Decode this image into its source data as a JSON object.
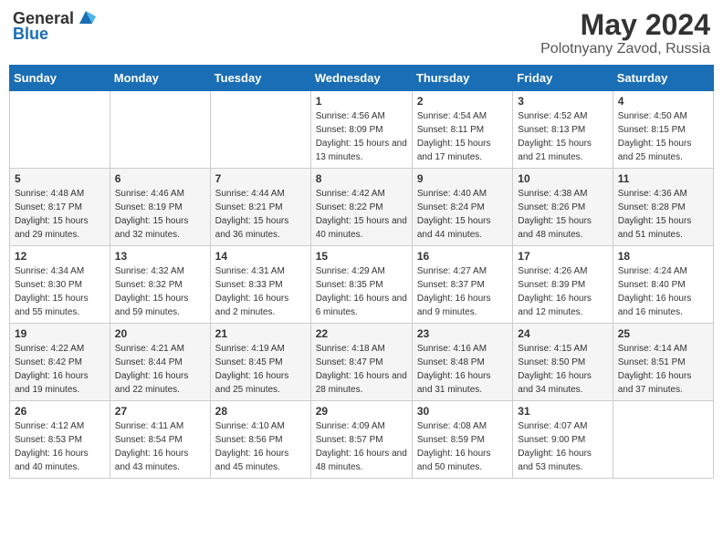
{
  "header": {
    "logo_general": "General",
    "logo_blue": "Blue",
    "title": "May 2024",
    "location": "Polotnyany Zavod, Russia"
  },
  "columns": [
    "Sunday",
    "Monday",
    "Tuesday",
    "Wednesday",
    "Thursday",
    "Friday",
    "Saturday"
  ],
  "weeks": [
    [
      {
        "day": "",
        "sunrise": "",
        "sunset": "",
        "daylight": ""
      },
      {
        "day": "",
        "sunrise": "",
        "sunset": "",
        "daylight": ""
      },
      {
        "day": "",
        "sunrise": "",
        "sunset": "",
        "daylight": ""
      },
      {
        "day": "1",
        "sunrise": "Sunrise: 4:56 AM",
        "sunset": "Sunset: 8:09 PM",
        "daylight": "Daylight: 15 hours and 13 minutes."
      },
      {
        "day": "2",
        "sunrise": "Sunrise: 4:54 AM",
        "sunset": "Sunset: 8:11 PM",
        "daylight": "Daylight: 15 hours and 17 minutes."
      },
      {
        "day": "3",
        "sunrise": "Sunrise: 4:52 AM",
        "sunset": "Sunset: 8:13 PM",
        "daylight": "Daylight: 15 hours and 21 minutes."
      },
      {
        "day": "4",
        "sunrise": "Sunrise: 4:50 AM",
        "sunset": "Sunset: 8:15 PM",
        "daylight": "Daylight: 15 hours and 25 minutes."
      }
    ],
    [
      {
        "day": "5",
        "sunrise": "Sunrise: 4:48 AM",
        "sunset": "Sunset: 8:17 PM",
        "daylight": "Daylight: 15 hours and 29 minutes."
      },
      {
        "day": "6",
        "sunrise": "Sunrise: 4:46 AM",
        "sunset": "Sunset: 8:19 PM",
        "daylight": "Daylight: 15 hours and 32 minutes."
      },
      {
        "day": "7",
        "sunrise": "Sunrise: 4:44 AM",
        "sunset": "Sunset: 8:21 PM",
        "daylight": "Daylight: 15 hours and 36 minutes."
      },
      {
        "day": "8",
        "sunrise": "Sunrise: 4:42 AM",
        "sunset": "Sunset: 8:22 PM",
        "daylight": "Daylight: 15 hours and 40 minutes."
      },
      {
        "day": "9",
        "sunrise": "Sunrise: 4:40 AM",
        "sunset": "Sunset: 8:24 PM",
        "daylight": "Daylight: 15 hours and 44 minutes."
      },
      {
        "day": "10",
        "sunrise": "Sunrise: 4:38 AM",
        "sunset": "Sunset: 8:26 PM",
        "daylight": "Daylight: 15 hours and 48 minutes."
      },
      {
        "day": "11",
        "sunrise": "Sunrise: 4:36 AM",
        "sunset": "Sunset: 8:28 PM",
        "daylight": "Daylight: 15 hours and 51 minutes."
      }
    ],
    [
      {
        "day": "12",
        "sunrise": "Sunrise: 4:34 AM",
        "sunset": "Sunset: 8:30 PM",
        "daylight": "Daylight: 15 hours and 55 minutes."
      },
      {
        "day": "13",
        "sunrise": "Sunrise: 4:32 AM",
        "sunset": "Sunset: 8:32 PM",
        "daylight": "Daylight: 15 hours and 59 minutes."
      },
      {
        "day": "14",
        "sunrise": "Sunrise: 4:31 AM",
        "sunset": "Sunset: 8:33 PM",
        "daylight": "Daylight: 16 hours and 2 minutes."
      },
      {
        "day": "15",
        "sunrise": "Sunrise: 4:29 AM",
        "sunset": "Sunset: 8:35 PM",
        "daylight": "Daylight: 16 hours and 6 minutes."
      },
      {
        "day": "16",
        "sunrise": "Sunrise: 4:27 AM",
        "sunset": "Sunset: 8:37 PM",
        "daylight": "Daylight: 16 hours and 9 minutes."
      },
      {
        "day": "17",
        "sunrise": "Sunrise: 4:26 AM",
        "sunset": "Sunset: 8:39 PM",
        "daylight": "Daylight: 16 hours and 12 minutes."
      },
      {
        "day": "18",
        "sunrise": "Sunrise: 4:24 AM",
        "sunset": "Sunset: 8:40 PM",
        "daylight": "Daylight: 16 hours and 16 minutes."
      }
    ],
    [
      {
        "day": "19",
        "sunrise": "Sunrise: 4:22 AM",
        "sunset": "Sunset: 8:42 PM",
        "daylight": "Daylight: 16 hours and 19 minutes."
      },
      {
        "day": "20",
        "sunrise": "Sunrise: 4:21 AM",
        "sunset": "Sunset: 8:44 PM",
        "daylight": "Daylight: 16 hours and 22 minutes."
      },
      {
        "day": "21",
        "sunrise": "Sunrise: 4:19 AM",
        "sunset": "Sunset: 8:45 PM",
        "daylight": "Daylight: 16 hours and 25 minutes."
      },
      {
        "day": "22",
        "sunrise": "Sunrise: 4:18 AM",
        "sunset": "Sunset: 8:47 PM",
        "daylight": "Daylight: 16 hours and 28 minutes."
      },
      {
        "day": "23",
        "sunrise": "Sunrise: 4:16 AM",
        "sunset": "Sunset: 8:48 PM",
        "daylight": "Daylight: 16 hours and 31 minutes."
      },
      {
        "day": "24",
        "sunrise": "Sunrise: 4:15 AM",
        "sunset": "Sunset: 8:50 PM",
        "daylight": "Daylight: 16 hours and 34 minutes."
      },
      {
        "day": "25",
        "sunrise": "Sunrise: 4:14 AM",
        "sunset": "Sunset: 8:51 PM",
        "daylight": "Daylight: 16 hours and 37 minutes."
      }
    ],
    [
      {
        "day": "26",
        "sunrise": "Sunrise: 4:12 AM",
        "sunset": "Sunset: 8:53 PM",
        "daylight": "Daylight: 16 hours and 40 minutes."
      },
      {
        "day": "27",
        "sunrise": "Sunrise: 4:11 AM",
        "sunset": "Sunset: 8:54 PM",
        "daylight": "Daylight: 16 hours and 43 minutes."
      },
      {
        "day": "28",
        "sunrise": "Sunrise: 4:10 AM",
        "sunset": "Sunset: 8:56 PM",
        "daylight": "Daylight: 16 hours and 45 minutes."
      },
      {
        "day": "29",
        "sunrise": "Sunrise: 4:09 AM",
        "sunset": "Sunset: 8:57 PM",
        "daylight": "Daylight: 16 hours and 48 minutes."
      },
      {
        "day": "30",
        "sunrise": "Sunrise: 4:08 AM",
        "sunset": "Sunset: 8:59 PM",
        "daylight": "Daylight: 16 hours and 50 minutes."
      },
      {
        "day": "31",
        "sunrise": "Sunrise: 4:07 AM",
        "sunset": "Sunset: 9:00 PM",
        "daylight": "Daylight: 16 hours and 53 minutes."
      },
      {
        "day": "",
        "sunrise": "",
        "sunset": "",
        "daylight": ""
      }
    ]
  ]
}
